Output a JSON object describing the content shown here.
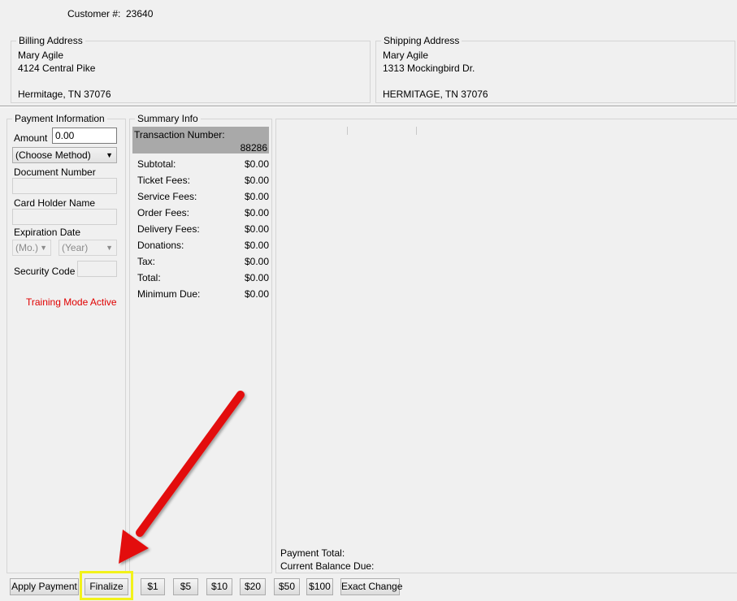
{
  "customer": {
    "label": "Customer #:",
    "number": "23640"
  },
  "billing": {
    "title": "Billing Address",
    "name": "Mary Agile",
    "street": "4124 Central Pike",
    "city": "Hermitage, TN 37076"
  },
  "shipping": {
    "title": "Shipping Address",
    "name": "Mary Agile",
    "street": "1313 Mockingbird Dr.",
    "city": "HERMITAGE, TN 37076"
  },
  "payment": {
    "title": "Payment Information",
    "amount_label": "Amount",
    "amount_value": "0.00",
    "method": "(Choose Method)",
    "doc_label": "Document Number",
    "holder_label": "Card Holder Name",
    "exp_label": "Expiration Date",
    "month": "(Mo.)",
    "year": "(Year)",
    "security_label": "Security Code",
    "training": "Training Mode Active"
  },
  "summary": {
    "title": "Summary Info",
    "txn_label": "Transaction Number:",
    "txn_value": "88286",
    "rows": [
      {
        "label": "Subtotal:",
        "value": "$0.00"
      },
      {
        "label": "Ticket Fees:",
        "value": "$0.00"
      },
      {
        "label": "Service Fees:",
        "value": "$0.00"
      },
      {
        "label": "Order Fees:",
        "value": "$0.00"
      },
      {
        "label": "Delivery Fees:",
        "value": "$0.00"
      },
      {
        "label": "Donations:",
        "value": "$0.00"
      },
      {
        "label": "Tax:",
        "value": "$0.00"
      },
      {
        "label": "Total:",
        "value": "$0.00"
      },
      {
        "label": "Minimum Due:",
        "value": "$0.00"
      }
    ]
  },
  "payments_panel": {
    "payment_total": "Payment Total:",
    "current_balance": "Current Balance Due:"
  },
  "buttons": {
    "apply": "Apply Payment",
    "finalize": "Finalize",
    "d1": "$1",
    "d5": "$5",
    "d10": "$10",
    "d20": "$20",
    "d50": "$50",
    "d100": "$100",
    "exact": "Exact Change"
  },
  "colors": {
    "highlight": "#f2f21a",
    "arrow": "#e31010",
    "training_text": "#e00000",
    "txn_header_bg": "#a9a9a9"
  },
  "annotation": {
    "icon": "red-arrow-icon"
  }
}
